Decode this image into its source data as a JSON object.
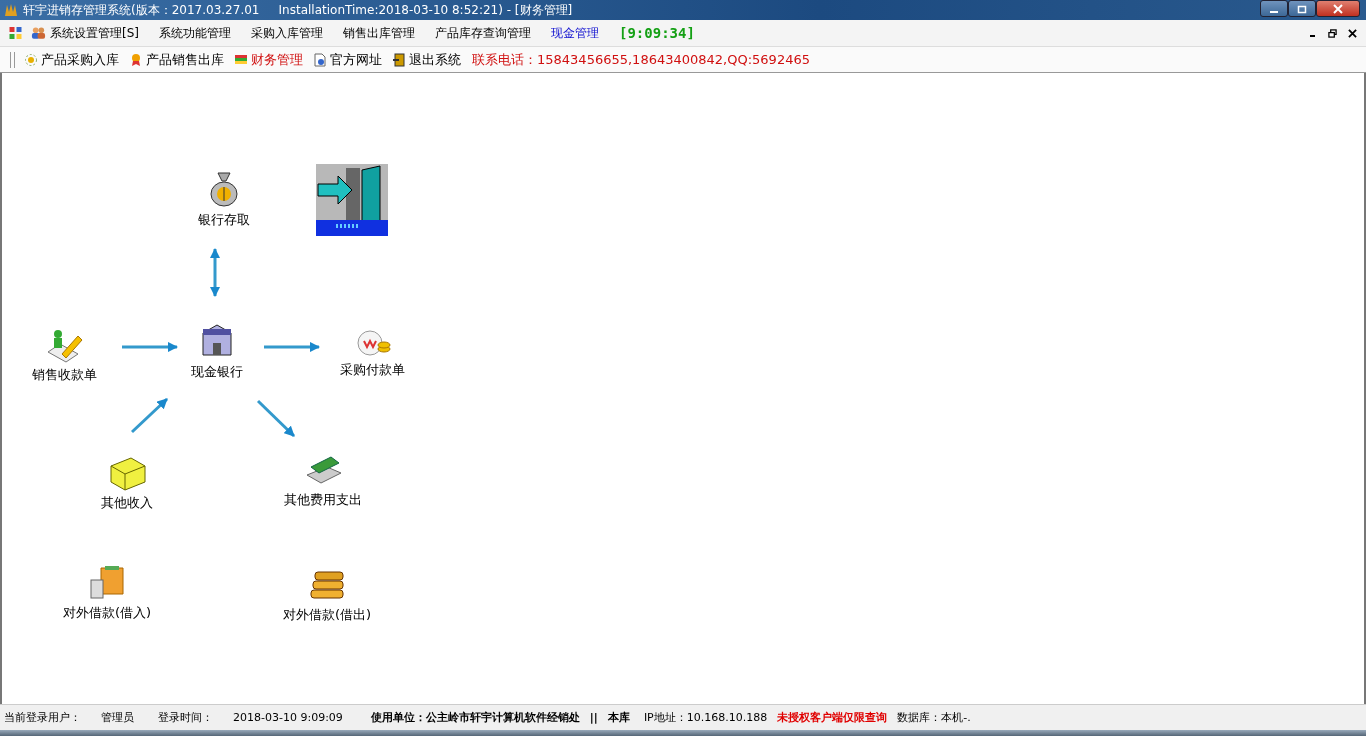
{
  "window": {
    "title": "轩宇进销存管理系统(版本：2017.03.27.01     InstallationTime:2018-03-10 8:52:21) - [财务管理]"
  },
  "menu": [
    {
      "label": "系统设置管理[S]",
      "selected": false
    },
    {
      "label": "系统功能管理",
      "selected": false
    },
    {
      "label": "采购入库管理",
      "selected": false
    },
    {
      "label": "销售出库管理",
      "selected": false
    },
    {
      "label": "产品库存查询管理",
      "selected": false
    },
    {
      "label": "现金管理",
      "selected": true
    }
  ],
  "clock": "[9:09:34]",
  "toolbar": [
    {
      "label": "产品采购入库",
      "selected": false
    },
    {
      "label": "产品销售出库",
      "selected": false
    },
    {
      "label": "财务管理",
      "selected": true
    },
    {
      "label": "官方网址",
      "selected": false
    },
    {
      "label": "退出系统",
      "selected": false
    }
  ],
  "contact": "联系电话：15843456655,18643400842,QQ:5692465",
  "diagram": {
    "nodes": [
      {
        "label": "银行存取"
      },
      {
        "label": "销售收款单"
      },
      {
        "label": "现金银行"
      },
      {
        "label": "采购付款单"
      },
      {
        "label": "其他收入"
      },
      {
        "label": "其他费用支出"
      },
      {
        "label": "对外借款(借入)"
      },
      {
        "label": "对外借款(借出)"
      }
    ]
  },
  "status_bar": [
    {
      "text": "当前登录用户：",
      "kind": "normal"
    },
    {
      "text": "管理员",
      "kind": "normal"
    },
    {
      "text": "登录时间：",
      "kind": "normal"
    },
    {
      "text": "2018-03-10 9:09:09",
      "kind": "normal"
    },
    {
      "text": "使用单位：公主岭市轩宇计算机软件经销处",
      "kind": "bold"
    },
    {
      "text": "||",
      "kind": "bold"
    },
    {
      "text": "本库",
      "kind": "bold"
    },
    {
      "text": "IP地址：10.168.10.188",
      "kind": "normal"
    },
    {
      "text": "未授权客户端仅限查询",
      "kind": "alert"
    },
    {
      "text": "数据库：本机-.",
      "kind": "normal"
    }
  ]
}
